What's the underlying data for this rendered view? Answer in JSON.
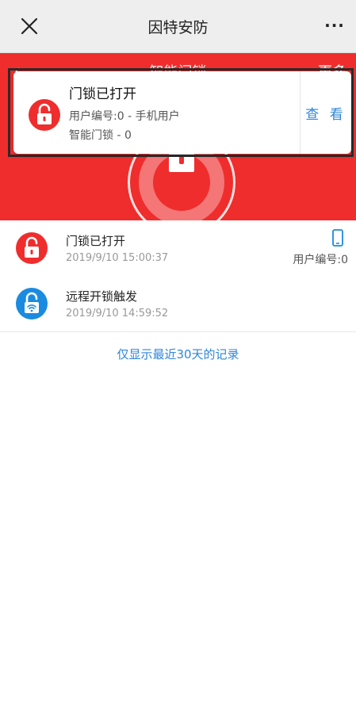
{
  "navbar": {
    "title": "因特安防",
    "close_icon": "close-icon",
    "more_label": "···"
  },
  "header": {
    "title": "智能门锁",
    "back_label": "‹",
    "more_label": "更多",
    "bg_color": "#ef2d2d"
  },
  "notification": {
    "title": "门锁已打开",
    "line1": "用户编号:0 - 手机用户",
    "line2": "智能门锁 - 0",
    "action_label": "查 看",
    "icon": "unlocked-lock-icon"
  },
  "records": [
    {
      "title": "门锁已打开",
      "time": "2019/9/10 15:00:37",
      "user": "用户编号:0",
      "icon": "unlocked-lock-icon",
      "icon_color": "#ef2d2d",
      "has_phone": true
    },
    {
      "title": "远程开锁触发",
      "time": "2019/9/10 14:59:52",
      "user": "",
      "icon": "wifi-lock-icon",
      "icon_color": "#1a8be0",
      "has_phone": false
    }
  ],
  "footnote": "仅显示最近30天的记录",
  "accent_color": "#2f86d8"
}
